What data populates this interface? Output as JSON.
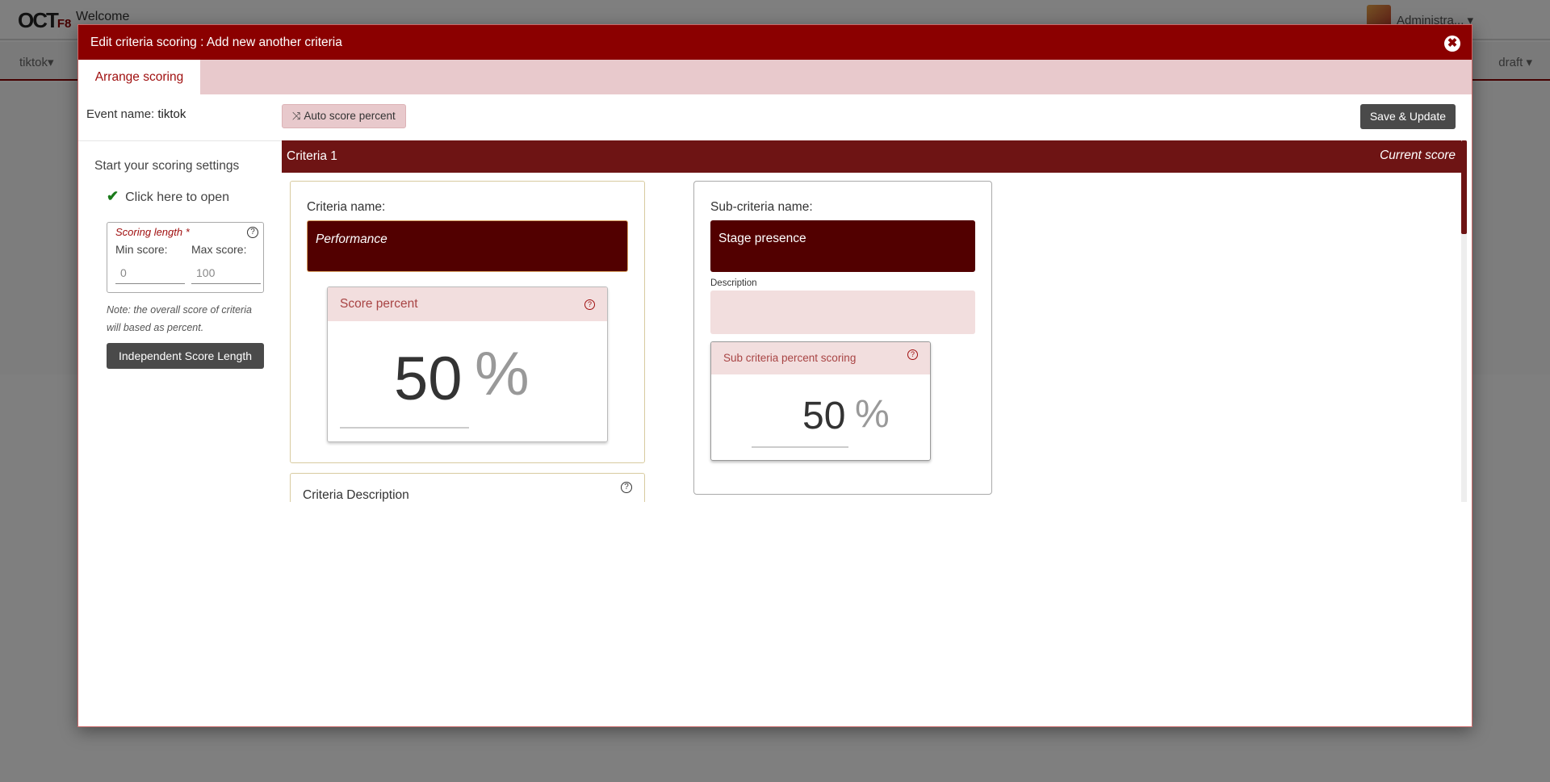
{
  "background": {
    "logo": "OCT",
    "logo_sub": "F8",
    "welcome": "Welcome",
    "user": "Administra...",
    "nav_left": "tiktok",
    "nav_right": "draft"
  },
  "modal": {
    "title": "Edit criteria scoring : Add new another criteria",
    "close_icon": "✖",
    "tab": "Arrange scoring",
    "event_label": "Event name:",
    "event_value": "tiktok",
    "auto_btn_icon": "⤨",
    "auto_btn": "Auto score percent",
    "save_btn": "Save & Update"
  },
  "left": {
    "title": "Start your scoring settings",
    "open_icon": "✔",
    "open_text": "Click here to open",
    "length_label": "Scoring length *",
    "help_icon": "?",
    "min_label": "Min score:",
    "max_label": "Max score:",
    "min_value": "0",
    "max_value": "100",
    "note": "Note: the overall score of criteria will based as percent.",
    "independent_btn": "Independent Score Length"
  },
  "criteria": {
    "title": "Criteria 1",
    "current_score": "Current score",
    "name_label": "Criteria name:",
    "name_value": "Performance",
    "score_title": "Score percent",
    "score_value": "50",
    "percent_sign": "%",
    "description_label": "Criteria Description"
  },
  "sub_criteria": {
    "name_label": "Sub-criteria name:",
    "name_value": "Stage presence",
    "description_label": "Description",
    "score_title": "Sub criteria percent scoring",
    "score_value": "50",
    "percent_sign": "%"
  },
  "colors": {
    "brand": "#8b0000",
    "criteria_bar": "#6e1414",
    "input_dark": "#520000",
    "pink": "#f2dede"
  }
}
